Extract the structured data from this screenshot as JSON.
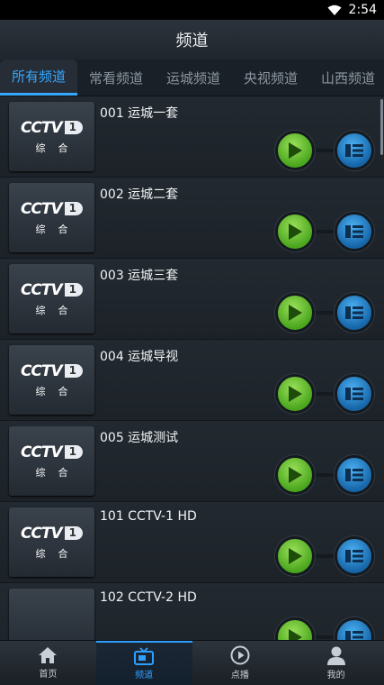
{
  "status": {
    "time": "2:54"
  },
  "header": {
    "title": "频道"
  },
  "tabs": [
    {
      "label": "所有频道",
      "active": true
    },
    {
      "label": "常看频道",
      "active": false
    },
    {
      "label": "运城频道",
      "active": false
    },
    {
      "label": "央视频道",
      "active": false
    },
    {
      "label": "山西频道",
      "active": false
    }
  ],
  "logo": {
    "brand": "CCTV",
    "number": "1",
    "subtitle": "综合"
  },
  "channels": [
    {
      "name": "001 运城一套",
      "has_logo": true
    },
    {
      "name": "002 运城二套",
      "has_logo": true
    },
    {
      "name": "003 运城三套",
      "has_logo": true
    },
    {
      "name": "004 运城导视",
      "has_logo": true
    },
    {
      "name": "005 运城测试",
      "has_logo": true
    },
    {
      "name": "101 CCTV-1 HD",
      "has_logo": true
    },
    {
      "name": "102 CCTV-2 HD",
      "has_logo": false
    }
  ],
  "bottom_nav": [
    {
      "label": "首页",
      "icon": "home-icon",
      "active": false
    },
    {
      "label": "频道",
      "icon": "tv-icon",
      "active": true
    },
    {
      "label": "点播",
      "icon": "play-circle-icon",
      "active": false
    },
    {
      "label": "我的",
      "icon": "user-icon",
      "active": false
    }
  ],
  "colors": {
    "accent": "#35a8ff",
    "play": "#5cc02a",
    "guide": "#1c78c4"
  }
}
